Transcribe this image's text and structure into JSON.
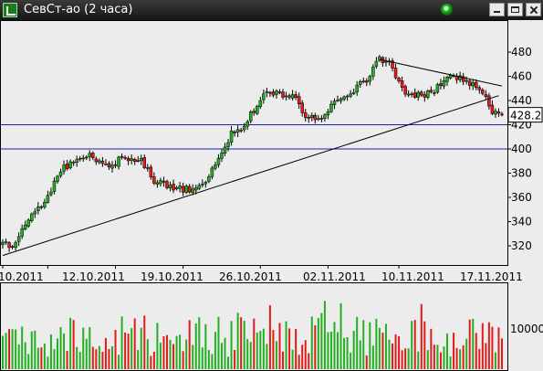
{
  "window": {
    "title": "СевСт-ао (2 часа)",
    "app_icon": "chart-icon",
    "status_indicator": "green-led-icon",
    "buttons": [
      "minimize",
      "maximize",
      "close"
    ]
  },
  "colors": {
    "background": "#ececec",
    "up_candle": "#22b022",
    "down_candle": "#e21b1b",
    "level_lines": "#1f1fb0",
    "trend_lines": "#000000",
    "last_price_box": "#ffffff"
  },
  "chart_data": [
    {
      "type": "candlestick",
      "title": "",
      "price_axis_ticks": [
        320,
        340,
        360,
        380,
        400,
        420,
        440,
        460,
        480
      ],
      "ylim": [
        306,
        494
      ],
      "last_price_label": "428.2",
      "date_labels": [
        "10.2011",
        "12.10.2011",
        "19.10.2011",
        "26.10.2011",
        "02.11.2011",
        "10.11.2011",
        "17.11.2011"
      ],
      "horizontal_levels": [
        420,
        400
      ],
      "trend_lines": [
        {
          "kind": "support",
          "from": {
            "bar": 0,
            "price": 312
          },
          "to": {
            "bar": 154,
            "price": 444
          }
        },
        {
          "kind": "resistance",
          "from": {
            "bar": 117,
            "price": 474
          },
          "to": {
            "bar": 155,
            "price": 452
          }
        }
      ],
      "path_points": [
        [
          0,
          322
        ],
        [
          4,
          320
        ],
        [
          8,
          343
        ],
        [
          13,
          356
        ],
        [
          18,
          382
        ],
        [
          23,
          392
        ],
        [
          28,
          394
        ],
        [
          33,
          386
        ],
        [
          38,
          394
        ],
        [
          43,
          390
        ],
        [
          47,
          374
        ],
        [
          51,
          370
        ],
        [
          55,
          368
        ],
        [
          59,
          365
        ],
        [
          63,
          375
        ],
        [
          67,
          392
        ],
        [
          71,
          412
        ],
        [
          75,
          420
        ],
        [
          78,
          432
        ],
        [
          82,
          448
        ],
        [
          86,
          446
        ],
        [
          90,
          444
        ],
        [
          94,
          428
        ],
        [
          98,
          425
        ],
        [
          101,
          432
        ],
        [
          105,
          442
        ],
        [
          109,
          448
        ],
        [
          113,
          458
        ],
        [
          117,
          474
        ],
        [
          120,
          470
        ],
        [
          123,
          455
        ],
        [
          126,
          444
        ],
        [
          130,
          445
        ],
        [
          134,
          447
        ],
        [
          138,
          462
        ],
        [
          142,
          459
        ],
        [
          146,
          452
        ],
        [
          150,
          446
        ],
        [
          152,
          430
        ],
        [
          155,
          428.2
        ]
      ]
    },
    {
      "type": "bar",
      "title": "",
      "series_label": "volume",
      "axis_ticks": [
        10000
      ],
      "ylim": [
        0,
        18000
      ]
    }
  ]
}
